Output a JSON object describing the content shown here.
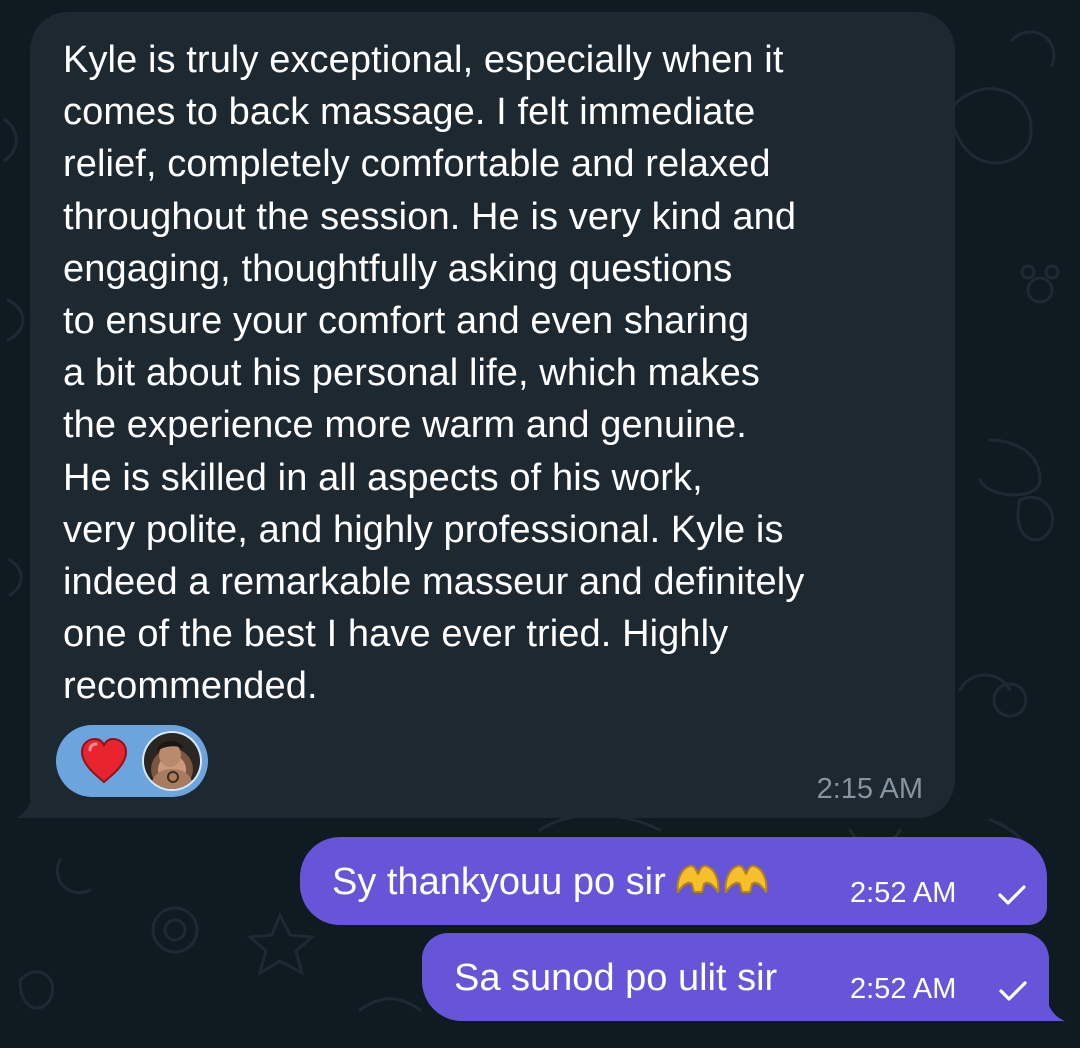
{
  "colors": {
    "background": "#0f1a21",
    "incoming_bubble": "#1e2831",
    "outgoing_bubble": "#6655d8",
    "reaction_pill": "#6ca5de",
    "timestamp_incoming": "#8694a0"
  },
  "incoming_message": {
    "text": "Kyle is truly exceptional, especially when it\ncomes to back massage. I felt immediate\nrelief, completely comfortable and relaxed\nthroughout the session. He is very kind and\nengaging, thoughtfully asking questions\nto ensure your comfort and even sharing\na bit about his personal life, which makes\nthe experience more warm and genuine.\nHe is skilled in all aspects of his work,\nvery polite, and highly professional. Kyle is\nindeed a remarkable masseur and definitely\none of the best I have ever tried. Highly\nrecommended.",
    "time": "2:15 AM",
    "reaction": {
      "emoji_icon": "red-heart-icon",
      "reactor": "avatar"
    }
  },
  "outgoing_messages": [
    {
      "text": "Sy thankyouu po sir",
      "emoji_icon": "heart-hands-icon",
      "time": "2:52 AM",
      "status_icon": "check-icon"
    },
    {
      "text": "Sa sunod po ulit sir",
      "time": "2:52 AM",
      "status_icon": "check-icon"
    }
  ]
}
